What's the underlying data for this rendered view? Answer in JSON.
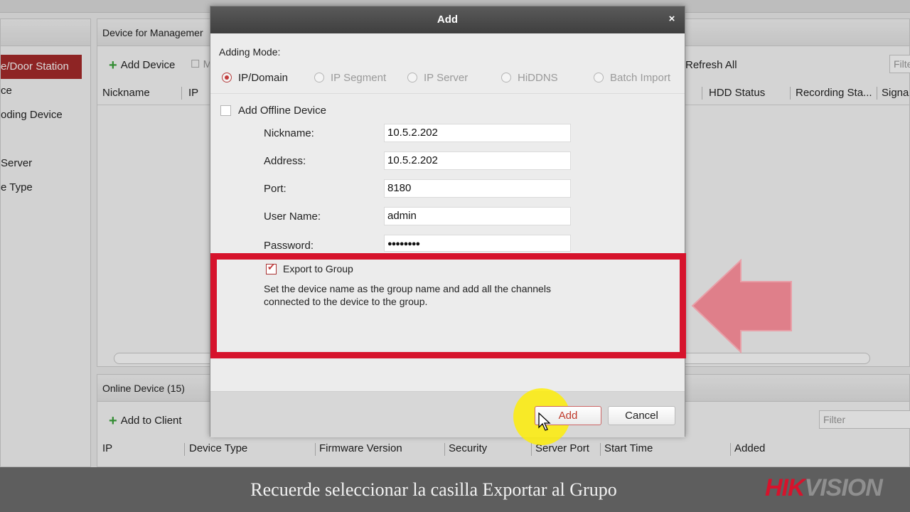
{
  "app": {
    "left_items": [
      "e/Door Station",
      "ce",
      "oding Device",
      "Server",
      "e Type"
    ],
    "main_title": "Device for Managemer",
    "toolbar": {
      "add_device": "Add Device",
      "truncated": "M",
      "refresh_all": "Refresh All"
    },
    "filter_placeholder": "Filte",
    "columns": [
      "Nickname",
      "IP",
      "HDD Status",
      "Recording Sta...",
      "Signa"
    ],
    "online": {
      "title": "Online Device (15)",
      "add_to_client": "Add to Client",
      "filter_placeholder": "Filter",
      "columns": [
        "IP",
        "Device Type",
        "Firmware Version",
        "Security",
        "Server Port",
        "Start Time",
        "Added"
      ]
    }
  },
  "dialog": {
    "title": "Add",
    "close": "×",
    "adding_mode_label": "Adding Mode:",
    "modes": [
      {
        "label": "IP/Domain",
        "selected": true
      },
      {
        "label": "IP Segment",
        "selected": false
      },
      {
        "label": "IP Server",
        "selected": false
      },
      {
        "label": "HiDDNS",
        "selected": false
      },
      {
        "label": "Batch Import",
        "selected": false
      }
    ],
    "offline_label": "Add Offline Device",
    "offline_checked": false,
    "fields": {
      "nickname": {
        "label": "Nickname:",
        "value": "10.5.2.202"
      },
      "address": {
        "label": "Address:",
        "value": "10.5.2.202"
      },
      "port": {
        "label": "Port:",
        "value": "8180"
      },
      "username": {
        "label": "User Name:",
        "value": "admin"
      },
      "password": {
        "label": "Password:",
        "value": "●●●●●●●●"
      }
    },
    "export_label": "Export to Group",
    "export_checked": true,
    "export_help_line1": "Set the device name as the group name and add all the channels",
    "export_help_line2": "connected to the device to the group.",
    "add_button": "Add",
    "cancel_button": "Cancel",
    "highlight_color": "#d6132c"
  },
  "caption": {
    "text": "Recuerde seleccionar la casilla Exportar al Grupo",
    "brand_hik": "HIK",
    "brand_vision": "VISION"
  }
}
